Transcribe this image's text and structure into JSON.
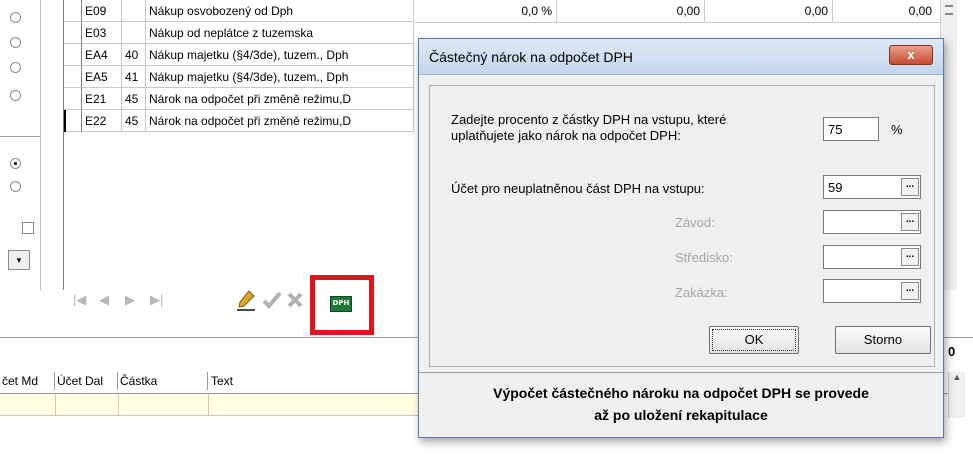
{
  "grid": {
    "rows": [
      {
        "code": "E09",
        "num": "",
        "text": "Nákup osvobozený od Dph",
        "pct": "0,0 %",
        "v1": "0,00",
        "v2": "0,00",
        "v3": "0,00"
      },
      {
        "code": "E03",
        "num": "",
        "text": "Nákup od neplátce z tuzemska",
        "pct": "",
        "v1": "",
        "v2": "",
        "v3": ""
      },
      {
        "code": "EA4",
        "num": "40",
        "text": "Nákup majetku (§4/3de), tuzem., Dph",
        "pct": "",
        "v1": "",
        "v2": "",
        "v3": ""
      },
      {
        "code": "EA5",
        "num": "41",
        "text": "Nákup majetku (§4/3de), tuzem., Dph",
        "pct": "",
        "v1": "",
        "v2": "",
        "v3": ""
      },
      {
        "code": "E21",
        "num": "45",
        "text": "Nárok na odpočet při změně režimu,D",
        "pct": "",
        "v1": "",
        "v2": "",
        "v3": ""
      },
      {
        "code": "E22",
        "num": "45",
        "text": "Nárok na odpočet při změně režimu,D",
        "pct": "",
        "v1": "",
        "v2": "",
        "v3": ""
      }
    ]
  },
  "bottom_grid": {
    "headers": [
      "čet Md",
      "Účet Dal",
      "Částka",
      "Text"
    ],
    "right_label": "0"
  },
  "toolbar": {
    "dph_label": "DPH",
    "pen_icon": "pen-icon",
    "check_icon": "check-icon",
    "cancel_icon": "x-icon"
  },
  "dialog": {
    "title": "Částečný nárok na odpočet DPH",
    "close": "x",
    "percent_prompt_line1": "Zadejte procento z částky DPH na vstupu, které",
    "percent_prompt_line2": "uplatňujete jako nárok na odpočet DPH:",
    "percent_value": "75",
    "percent_unit": "%",
    "account_label": "Účet pro neuplatněnou část DPH na vstupu:",
    "account_value": "59",
    "zavod_label": "Závod:",
    "stredisko_label": "Středisko:",
    "zakazka_label": "Zakázka:",
    "ok_label": "OK",
    "storno_label": "Storno",
    "note_line1": "Výpočet částečného nároku na odpočet DPH se provede",
    "note_line2": "až po uložení rekapitulace",
    "dots": "..."
  },
  "colors": {
    "highlight": "#e0141e",
    "yellow_row": "#ffffe1"
  }
}
